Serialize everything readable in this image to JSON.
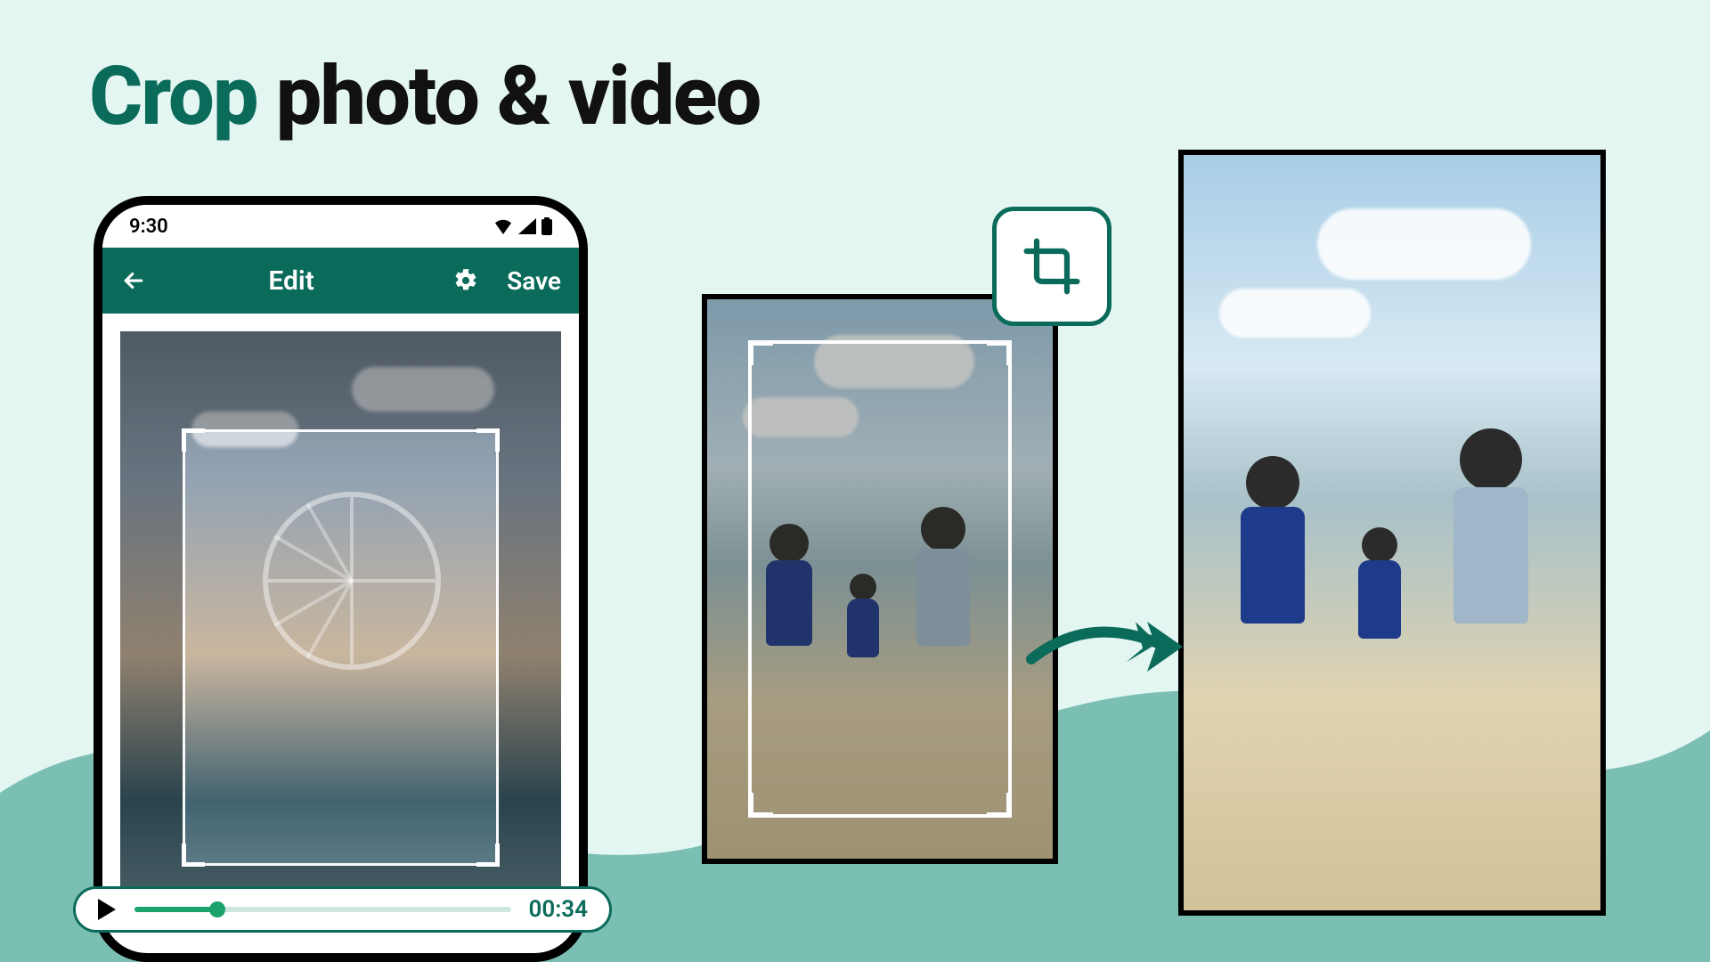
{
  "headline": {
    "accent": "Crop",
    "rest": " photo & video"
  },
  "phone": {
    "status_time": "9:30",
    "appbar_title": "Edit",
    "save_label": "Save"
  },
  "playback": {
    "time_label": "00:34",
    "progress_percent": 22
  },
  "icons": {
    "back": "back-arrow-icon",
    "gear": "gear-icon",
    "play": "play-icon",
    "wifi": "wifi-icon",
    "signal": "signal-icon",
    "battery": "battery-icon",
    "crop": "crop-icon",
    "arrow": "arrow-right-icon"
  }
}
